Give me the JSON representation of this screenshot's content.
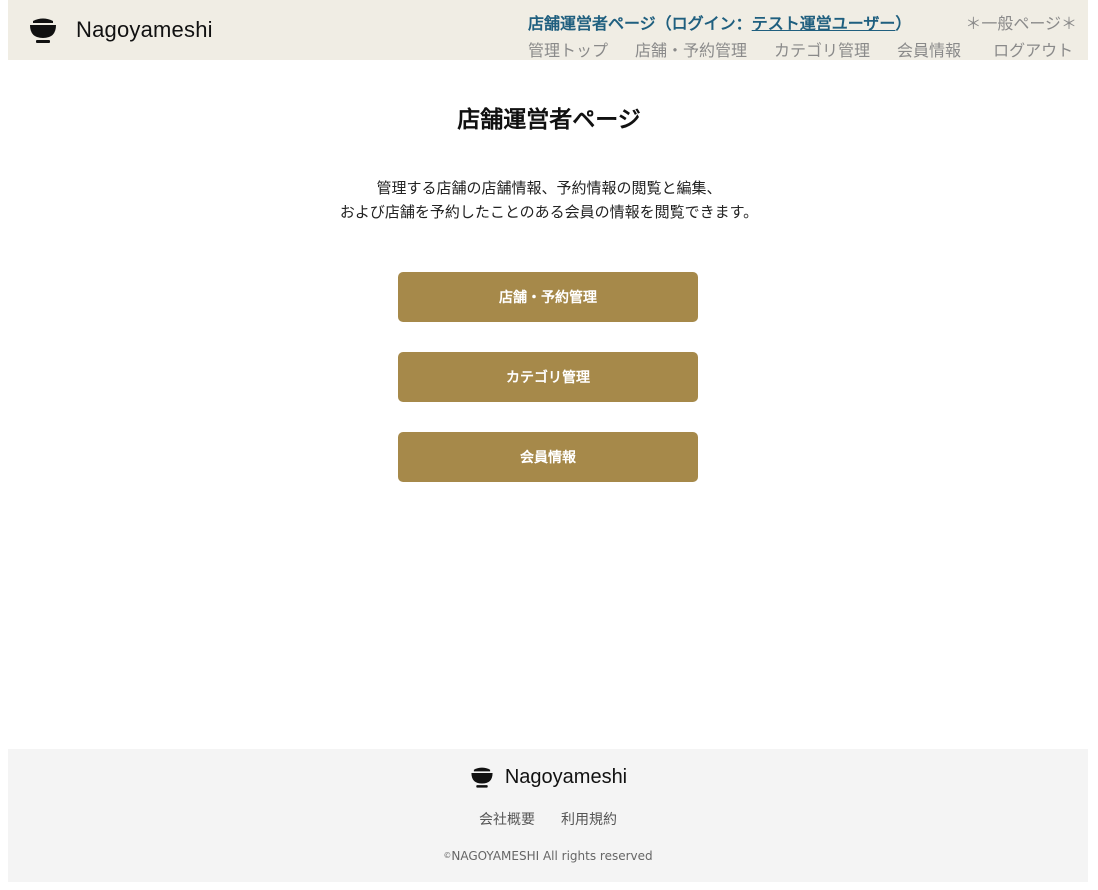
{
  "header": {
    "brand": "Nagoyameshi",
    "status_prefix": "店舗運営者ページ（ログイン：",
    "user_name": "テスト運営ユーザー",
    "status_suffix": "）",
    "general_link": "＊一般ページ＊",
    "nav": {
      "admin_top": "管理トップ",
      "store_reservation": "店舗・予約管理",
      "category": "カテゴリ管理",
      "member_info": "会員情報",
      "logout": "ログアウト"
    }
  },
  "main": {
    "title": "店舗運営者ページ",
    "description_line1": "管理する店舗の店舗情報、予約情報の閲覧と編集、",
    "description_line2": "および店舗を予約したことのある会員の情報を閲覧できます。",
    "buttons": {
      "store_reservation": "店舗・予約管理",
      "category": "カテゴリ管理",
      "member_info": "会員情報"
    }
  },
  "footer": {
    "brand": "Nagoyameshi",
    "company": "会社概要",
    "terms": "利用規約",
    "copyright_mark": "©",
    "copyright_text": "NAGOYAMESHI All rights reserved"
  },
  "colors": {
    "header_bg": "#f0ede4",
    "accent_button": "#a6894a",
    "status_text": "#1f5f7f",
    "footer_bg": "#f4f4f4"
  },
  "icons": {
    "logo": "rice-bowl-icon"
  }
}
